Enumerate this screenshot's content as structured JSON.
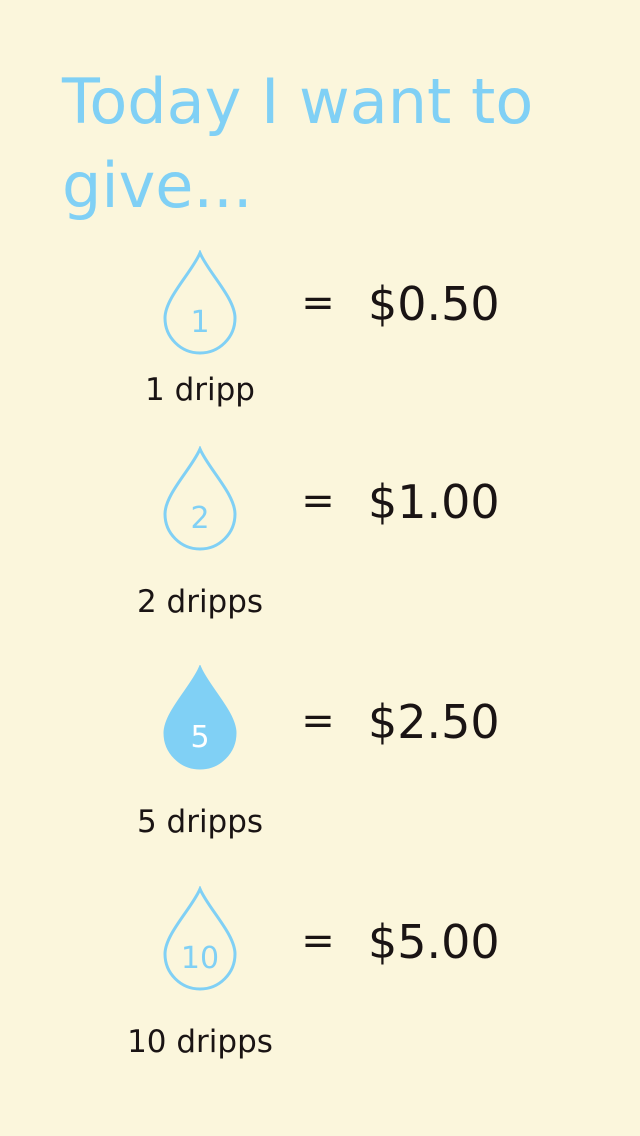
{
  "title": "Today I want to give...",
  "accent_color": "#80d0f5",
  "text_color": "#1a1414",
  "background_color": "#fbf6dc",
  "equals_sign": "=",
  "options": [
    {
      "drop_number": "1",
      "label": "1 dripp",
      "price": "$0.50",
      "selected": false,
      "icon": "water-drop-outline-icon"
    },
    {
      "drop_number": "2",
      "label": "2 dripps",
      "price": "$1.00",
      "selected": false,
      "icon": "water-drop-outline-icon"
    },
    {
      "drop_number": "5",
      "label": "5 dripps",
      "price": "$2.50",
      "selected": true,
      "icon": "water-drop-filled-icon"
    },
    {
      "drop_number": "10",
      "label": "10 dripps",
      "price": "$5.00",
      "selected": false,
      "icon": "water-drop-outline-icon"
    }
  ]
}
